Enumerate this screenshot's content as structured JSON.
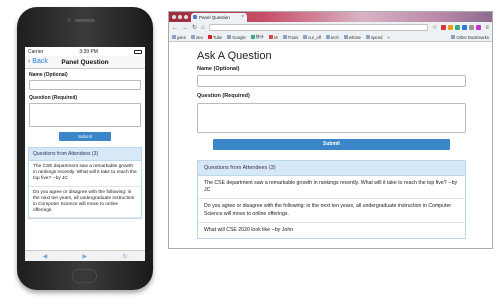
{
  "mobile": {
    "status": {
      "carrier": "Carrier",
      "time": "3:39 PM"
    },
    "nav": {
      "back_label": "Back",
      "title": "Panel Question"
    },
    "form": {
      "name_label": "Name (Optional)",
      "question_label": "Question (Required)",
      "submit_label": "Submit"
    },
    "questions_header": "Questions from Attendees (3)",
    "questions": [
      "The CSE department saw a remarkable growth in rankings recently. What will it take to reach the top five? --by JC",
      "Do you agree or disagree with the following: in the next ten years, all undergraduate instruction in Computer Science will move to online offerings."
    ]
  },
  "browser": {
    "tab_title": "Panel Question",
    "bookmarks": [
      "gsen",
      "dev",
      "Tube",
      "Google",
      "统计",
      "M",
      "Trans",
      "cur_off",
      "tech",
      "whose",
      "spend",
      "»",
      "Other Bookmarks"
    ],
    "ext_colors": [
      "#d33",
      "#e8a020",
      "#3a8",
      "#2a7ad8",
      "#999",
      "#c3c"
    ]
  },
  "desktop": {
    "heading": "Ask A Question",
    "name_label": "Name (Optional)",
    "question_label": "Question (Required)",
    "submit_label": "Submit",
    "questions_header": "Questions from Attendees (3)",
    "questions": [
      "The CSE department saw a remarkable growth in rankings recently. What will it take to reach the top five? --by JC",
      "Do you agree or disagree with the following: in the next ten years, all undergraduate instruction in Computer Science will move to online offerings.",
      "What will CSE 2020 look like --by John"
    ]
  },
  "colors": {
    "accent": "#3a86c8",
    "panel_header": "#d7e9f6"
  }
}
